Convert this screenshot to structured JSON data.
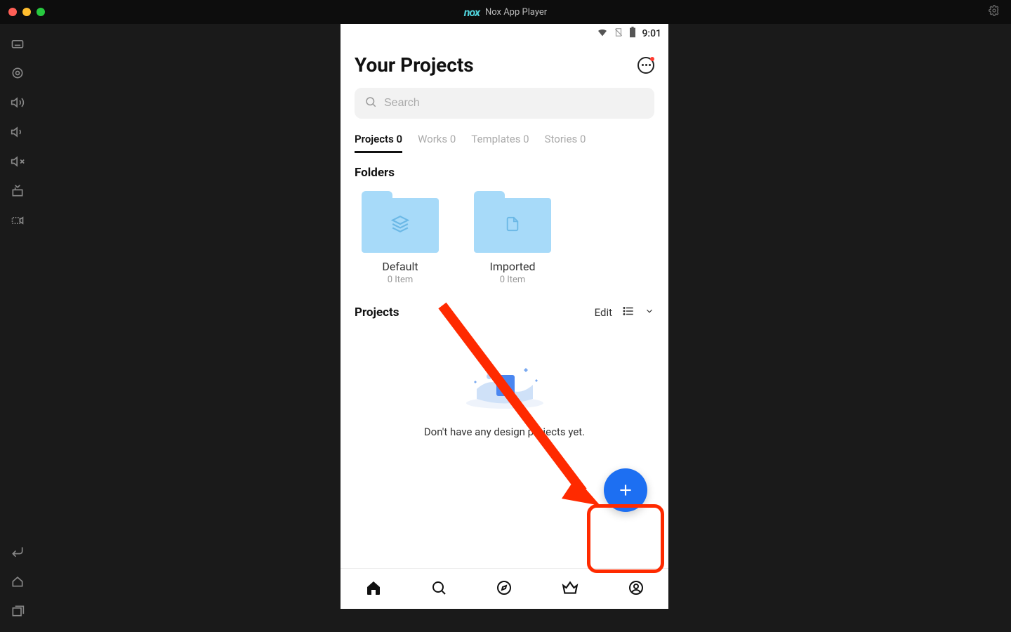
{
  "titlebar": {
    "app_name": "Nox App Player",
    "logo_text": "nox"
  },
  "status_bar": {
    "time": "9:01"
  },
  "header": {
    "title": "Your Projects"
  },
  "search": {
    "placeholder": "Search"
  },
  "tabs": [
    {
      "label": "Projects 0",
      "active": true
    },
    {
      "label": "Works 0",
      "active": false
    },
    {
      "label": "Templates 0",
      "active": false
    },
    {
      "label": "Stories 0",
      "active": false
    }
  ],
  "folders_section": {
    "title": "Folders"
  },
  "folders": [
    {
      "name": "Default",
      "count": "0 Item",
      "icon": "stack-icon"
    },
    {
      "name": "Imported",
      "count": "0 Item",
      "icon": "file-icon"
    }
  ],
  "projects_section": {
    "title": "Projects",
    "edit_label": "Edit"
  },
  "empty": {
    "message": "Don't have any design projects yet."
  }
}
